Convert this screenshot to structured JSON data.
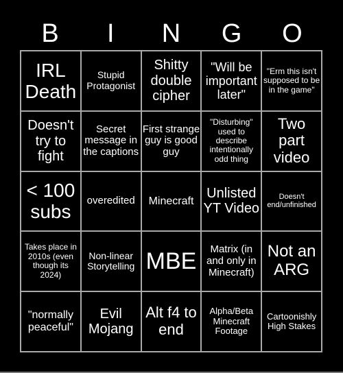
{
  "header": {
    "letters": [
      "B",
      "I",
      "N",
      "G",
      "O"
    ]
  },
  "cells": [
    "IRL Death",
    "Stupid Protagonist",
    "Shitty double cipher",
    "\"Will be important later\"",
    "\"Erm this isn't supposed to be in the game\"",
    "Doesn't try to fight",
    "Secret message in the captions",
    "First strange guy is good guy",
    "\"Disturbing\" used to describe intentionally odd thing",
    "Two part video",
    "< 100 subs",
    "overedited",
    "Minecraft",
    "Unlisted YT Video",
    "Doesn't end/unfinished",
    "Takes place in 2010s (even though its 2024)",
    "Non-linear Storytelling",
    "MBE",
    "Matrix (in and only in Minecraft)",
    "Not an ARG",
    "\"normally peaceful\"",
    "Evil Mojang",
    "Alt f4 to end",
    "Alpha/Beta Minecraft Footage",
    "Cartoonishly High Stakes"
  ],
  "colors": {
    "background": "#000000",
    "text": "#ffffff",
    "grid_line": "#aaaaaa"
  }
}
